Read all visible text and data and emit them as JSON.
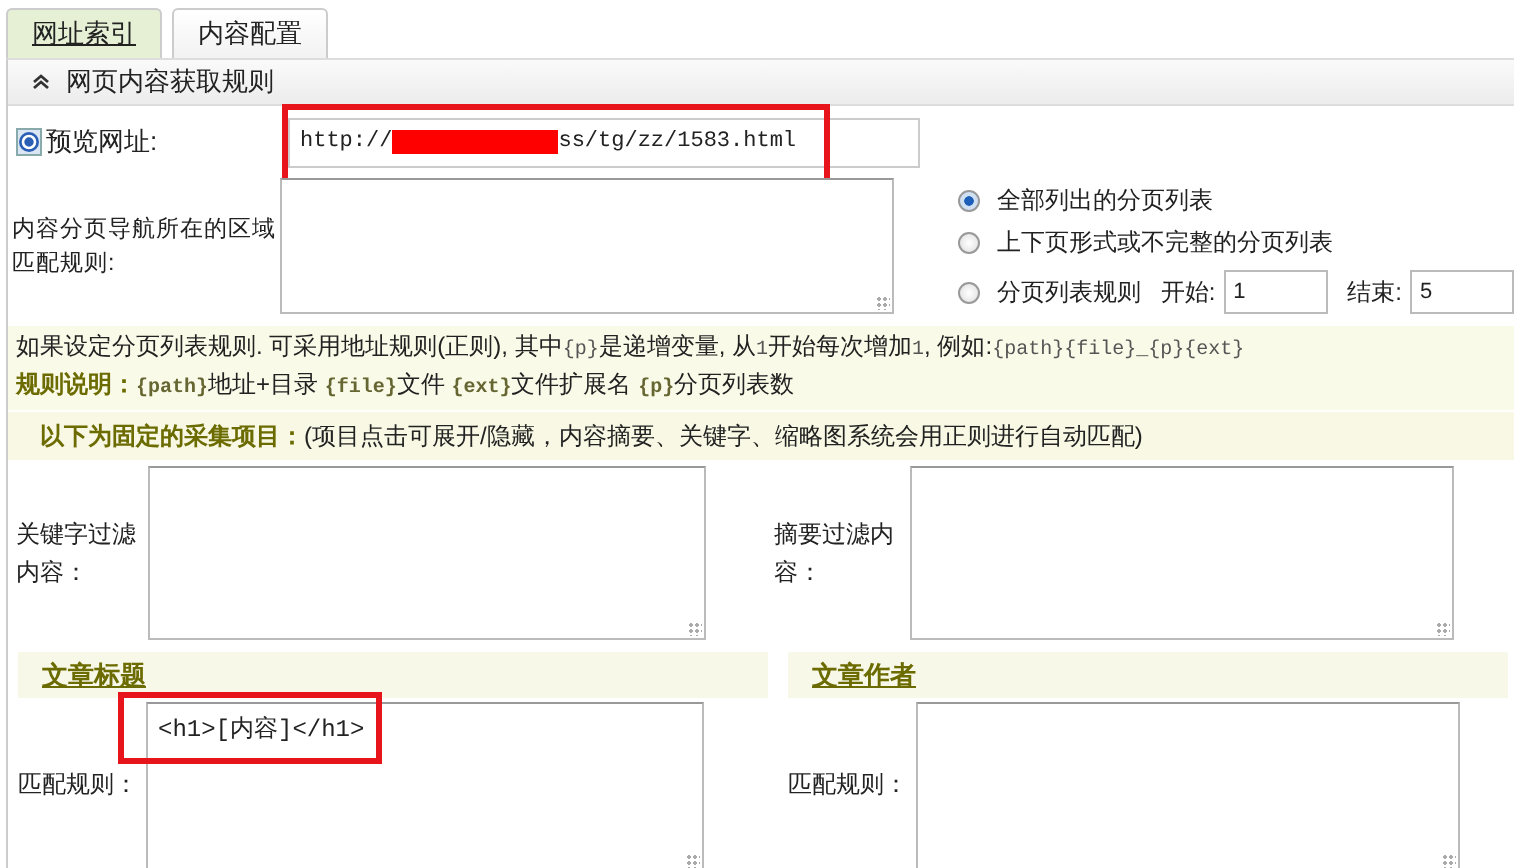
{
  "tabs": [
    {
      "label": "网址索引",
      "selected": true
    },
    {
      "label": "内容配置",
      "selected": false
    }
  ],
  "section": {
    "title": "网页内容获取规则",
    "expanded": true
  },
  "preview_url": {
    "label": "预览网址:",
    "prefix": "http://",
    "suffix": "ss/tg/zz/1583.html",
    "redacted": true,
    "highlighted": true
  },
  "pagination": {
    "label": "内容分页导航所在的区域匹配规则:",
    "options": [
      {
        "label": "全部列出的分页列表",
        "selected": true
      },
      {
        "label": "上下页形式或不完整的分页列表",
        "selected": false
      },
      {
        "label": "分页列表规则",
        "selected": false
      }
    ],
    "start_label": "开始:",
    "start_value": "1",
    "end_label": "结束:",
    "end_value": "5"
  },
  "hint": [
    [
      {
        "kind": "text",
        "text": "如果设定分页列表规则. 可采用地址规则(正则), 其中"
      },
      {
        "kind": "code",
        "text": "{p}"
      },
      {
        "kind": "text",
        "text": "是递增变量, 从"
      },
      {
        "kind": "code",
        "text": "1"
      },
      {
        "kind": "text",
        "text": "开始每次增加"
      },
      {
        "kind": "code",
        "text": "1"
      },
      {
        "kind": "text",
        "text": ", 例如:"
      },
      {
        "kind": "code",
        "text": "{path}{file}_{p}{ext}"
      }
    ],
    [
      {
        "kind": "label",
        "text": "规则说明："
      },
      {
        "kind": "code",
        "text": "{path}"
      },
      {
        "kind": "text",
        "text": "地址+目录 "
      },
      {
        "kind": "code",
        "text": "{file}"
      },
      {
        "kind": "text",
        "text": "文件 "
      },
      {
        "kind": "code",
        "text": "{ext}"
      },
      {
        "kind": "text",
        "text": "文件扩展名 "
      },
      {
        "kind": "code",
        "text": "{p}"
      },
      {
        "kind": "text",
        "text": "分页列表数"
      }
    ]
  ],
  "fixed_items": {
    "title": "以下为固定的采集项目：",
    "note": "(项目点击可展开/隐藏，内容摘要、关键字、缩略图系统会用正则进行自动匹配)"
  },
  "filters": [
    {
      "label": "关键字过滤内容："
    },
    {
      "label": "摘要过滤内容："
    }
  ],
  "fields": [
    {
      "title": "文章标题",
      "label": "匹配规则：",
      "value": "<h1>[内容]</h1>",
      "highlighted": true
    },
    {
      "title": "文章作者",
      "label": "匹配规则："
    }
  ]
}
